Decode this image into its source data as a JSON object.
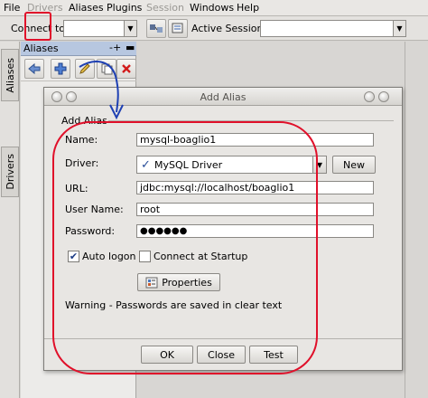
{
  "menubar": {
    "items": [
      {
        "label": "File",
        "disabled": false
      },
      {
        "label": "Drivers",
        "disabled": true
      },
      {
        "label": "Aliases",
        "disabled": false
      },
      {
        "label": "Plugins",
        "disabled": false
      },
      {
        "label": "Session",
        "disabled": true
      },
      {
        "label": "Windows",
        "disabled": false
      },
      {
        "label": "Help",
        "disabled": false
      }
    ]
  },
  "toolbar": {
    "connect_to_label": "Connect to:",
    "connect_to_value": "",
    "active_session_label": "Active Session:",
    "active_session_value": ""
  },
  "left_rail": {
    "tabs": [
      {
        "label": "Aliases"
      },
      {
        "label": "Drivers"
      }
    ]
  },
  "aliases_panel": {
    "title": "Aliases",
    "pin_glyph": "-+",
    "minimize_glyph": "▬"
  },
  "dialog": {
    "title": "Add Alias",
    "group_caption": "Add Alias",
    "name_label": "Name:",
    "name_value": "mysql-boaglio1",
    "driver_label": "Driver:",
    "driver_value": "MySQL Driver",
    "new_button": "New",
    "url_label": "URL:",
    "url_value": "jdbc:mysql://localhost/boaglio1",
    "username_label": "User Name:",
    "username_value": "root",
    "password_label": "Password:",
    "password_value": "●●●●●●",
    "auto_logon_label": "Auto logon",
    "auto_logon_checked": true,
    "connect_startup_label": "Connect at Startup",
    "connect_startup_checked": false,
    "properties_button": "Properties",
    "warning_text": "Warning - Passwords are saved in clear text",
    "ok_button": "OK",
    "close_button": "Close",
    "test_button": "Test"
  },
  "colors": {
    "annotation_red": "#e0102a",
    "annotation_blue": "#1d3fb3",
    "panel_header": "#b7c7e0"
  }
}
